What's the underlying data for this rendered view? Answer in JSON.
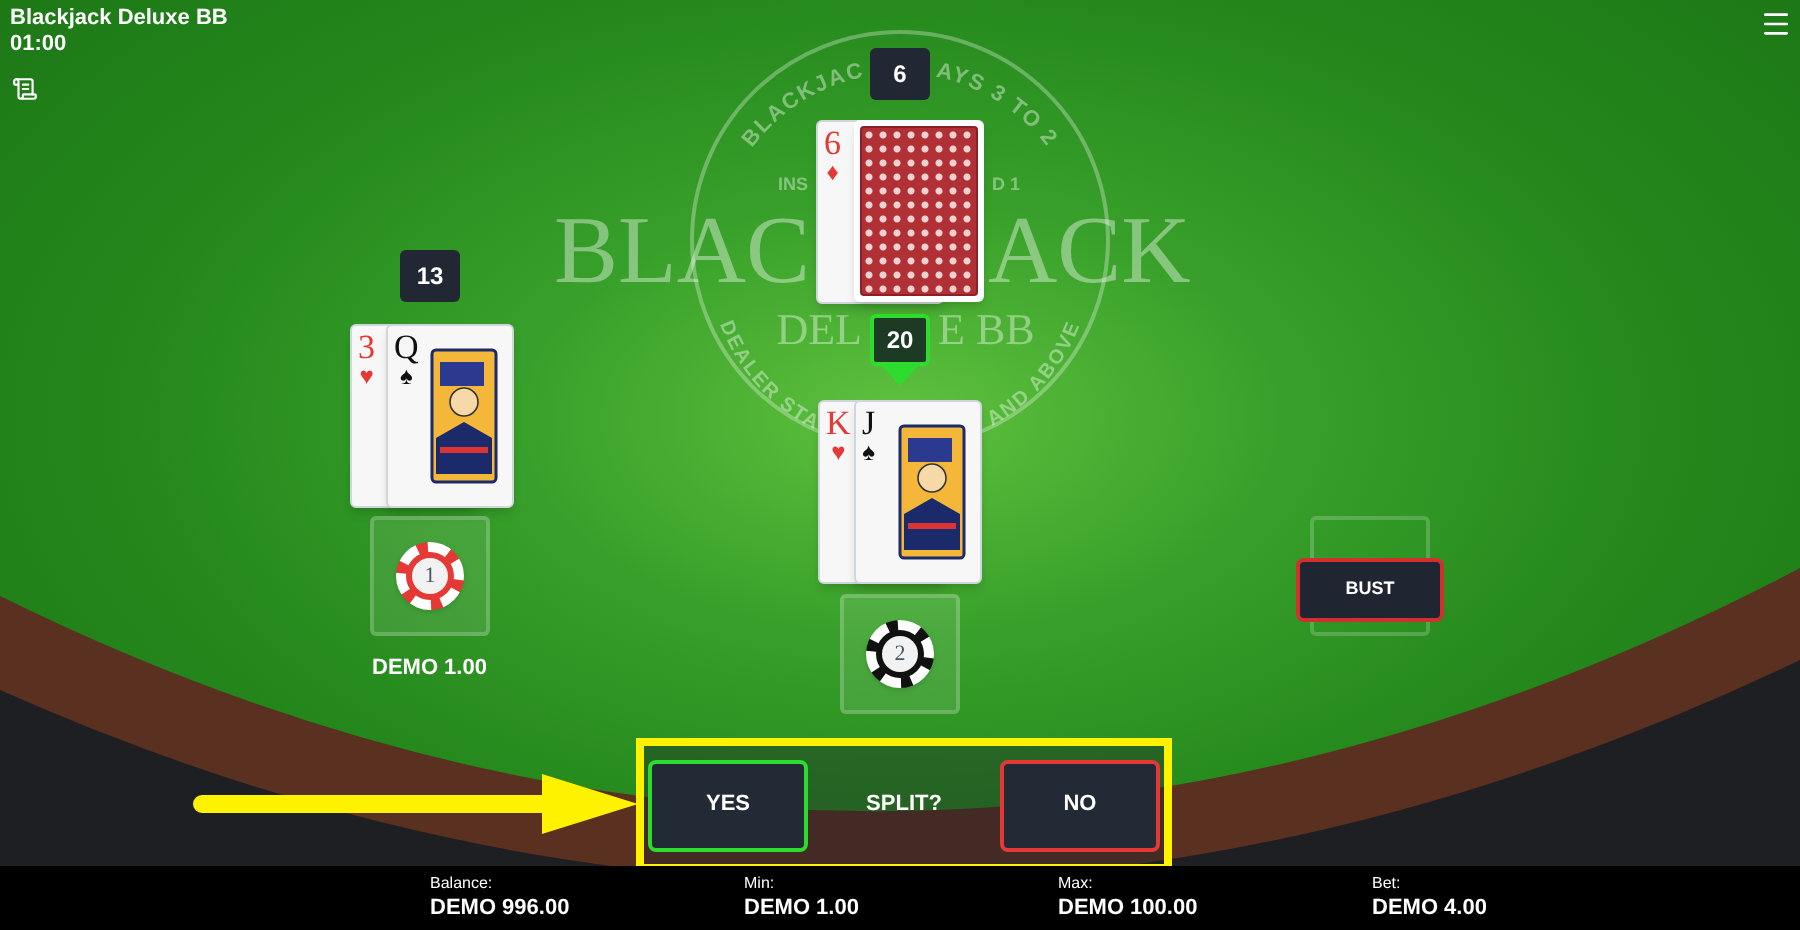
{
  "header": {
    "title": "Blackjack Deluxe BB",
    "timer": "01:00"
  },
  "table_logo": [
    {
      "text": "BLACKJAC",
      "kind": "top_arc_start"
    },
    {
      "text": "AYS 3 TO 2",
      "kind": "top_arc_end"
    },
    {
      "text": "INS",
      "kind": "line_left"
    },
    {
      "text": "D 1",
      "kind": "line_right"
    },
    {
      "text": "BLAC",
      "kind": "title_left"
    },
    {
      "text": "ACK",
      "kind": "title_right"
    },
    {
      "text": "DEALER STA",
      "kind": "bottom_arc_start"
    },
    {
      "text": "DEL",
      "kind": "subtitle_left"
    },
    {
      "text": "E BB",
      "kind": "subtitle_right"
    },
    {
      "text": "AND ABOVE",
      "kind": "bottom_arc_end"
    }
  ],
  "dealer": {
    "score": "6",
    "cards": [
      {
        "face_up": true,
        "rank": "6",
        "suit": "♦",
        "color": "#e53935"
      },
      {
        "face_up": false
      }
    ]
  },
  "hands": [
    {
      "score": "13",
      "active": false,
      "bet": "DEMO 1.00",
      "chip": {
        "value": "1",
        "color": "#e53935"
      },
      "cards": [
        {
          "face_up": true,
          "rank": "3",
          "suit": "♥",
          "color": "#e53935"
        },
        {
          "face_up": true,
          "rank": "Q",
          "suit": "♠",
          "color": "#111111",
          "court": true
        }
      ]
    },
    {
      "score": "20",
      "active": true,
      "chip": {
        "value": "2",
        "color": "#111111"
      },
      "cards": [
        {
          "face_up": true,
          "rank": "K",
          "suit": "♥",
          "color": "#e53935"
        },
        {
          "face_up": true,
          "rank": "J",
          "suit": "♠",
          "color": "#111111",
          "court": true
        }
      ]
    }
  ],
  "bust_spot": {
    "label": "BUST"
  },
  "split_prompt": {
    "question": "SPLIT?",
    "buttons": [
      {
        "label": "YES",
        "kind": "yes"
      },
      {
        "label": "NO",
        "kind": "no"
      }
    ]
  },
  "status_bar": [
    {
      "label": "Balance:",
      "value": "DEMO 996.00"
    },
    {
      "label": "Min:",
      "value": "DEMO 1.00"
    },
    {
      "label": "Max:",
      "value": "DEMO 100.00"
    },
    {
      "label": "Bet:",
      "value": "DEMO 4.00"
    }
  ]
}
